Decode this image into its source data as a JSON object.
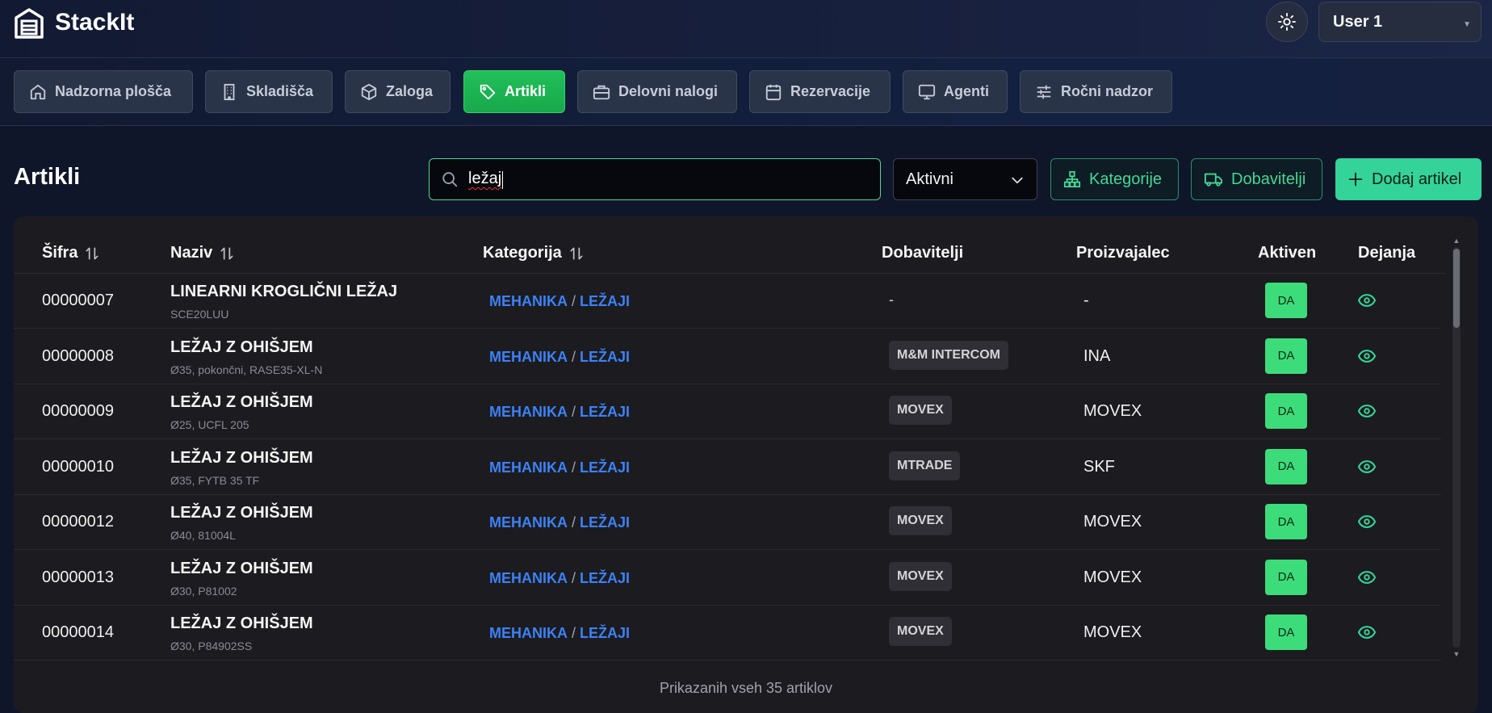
{
  "app": {
    "name": "StackIt"
  },
  "header": {
    "user": "User 1"
  },
  "nav": [
    {
      "label": "Nadzorna plošča",
      "icon": "home-icon",
      "active": false
    },
    {
      "label": "Skladišča",
      "icon": "building-icon",
      "active": false
    },
    {
      "label": "Zaloga",
      "icon": "box-icon",
      "active": false
    },
    {
      "label": "Artikli",
      "icon": "tag-icon",
      "active": true
    },
    {
      "label": "Delovni nalogi",
      "icon": "briefcase-icon",
      "active": false
    },
    {
      "label": "Rezervacije",
      "icon": "calendar-icon",
      "active": false
    },
    {
      "label": "Agenti",
      "icon": "monitor-icon",
      "active": false
    },
    {
      "label": "Ročni nadzor",
      "icon": "sliders-icon",
      "active": false
    }
  ],
  "page": {
    "title": "Artikli",
    "search_value": "ležaj",
    "status_filter": "Aktivni",
    "btn_categories": "Kategorije",
    "btn_suppliers": "Dobavitelji",
    "btn_add": "Dodaj artikel"
  },
  "table": {
    "headers": {
      "code": "Šifra",
      "name": "Naziv",
      "category": "Kategorija",
      "suppliers": "Dobavitelji",
      "manufacturer": "Proizvajalec",
      "active": "Aktiven",
      "actions": "Dejanja"
    },
    "rows": [
      {
        "code": "00000007",
        "name": "LINEARNI KROGLIČNI LEŽAJ",
        "sub": "SCE20LUU",
        "cat1": "MEHANIKA",
        "cat2": "LEŽAJI",
        "supplier": "-",
        "manufacturer": "-",
        "active": "DA"
      },
      {
        "code": "00000008",
        "name": "LEŽAJ Z OHIŠJEM",
        "sub": "Ø35, pokončni, RASE35-XL-N",
        "cat1": "MEHANIKA",
        "cat2": "LEŽAJI",
        "supplier": "M&M INTERCOM",
        "manufacturer": "INA",
        "active": "DA"
      },
      {
        "code": "00000009",
        "name": "LEŽAJ Z OHIŠJEM",
        "sub": "Ø25, UCFL 205",
        "cat1": "MEHANIKA",
        "cat2": "LEŽAJI",
        "supplier": "MOVEX",
        "manufacturer": "MOVEX",
        "active": "DA"
      },
      {
        "code": "00000010",
        "name": "LEŽAJ Z OHIŠJEM",
        "sub": "Ø35, FYTB 35 TF",
        "cat1": "MEHANIKA",
        "cat2": "LEŽAJI",
        "supplier": "MTRADE",
        "manufacturer": "SKF",
        "active": "DA"
      },
      {
        "code": "00000012",
        "name": "LEŽAJ Z OHIŠJEM",
        "sub": "Ø40, 81004L",
        "cat1": "MEHANIKA",
        "cat2": "LEŽAJI",
        "supplier": "MOVEX",
        "manufacturer": "MOVEX",
        "active": "DA"
      },
      {
        "code": "00000013",
        "name": "LEŽAJ Z OHIŠJEM",
        "sub": "Ø30, P81002",
        "cat1": "MEHANIKA",
        "cat2": "LEŽAJI",
        "supplier": "MOVEX",
        "manufacturer": "MOVEX",
        "active": "DA"
      },
      {
        "code": "00000014",
        "name": "LEŽAJ Z OHIŠJEM",
        "sub": "Ø30, P84902SS",
        "cat1": "MEHANIKA",
        "cat2": "LEŽAJI",
        "supplier": "MOVEX",
        "manufacturer": "MOVEX",
        "active": "DA"
      }
    ],
    "footer": "Prikazanih vseh 35 artiklov"
  }
}
